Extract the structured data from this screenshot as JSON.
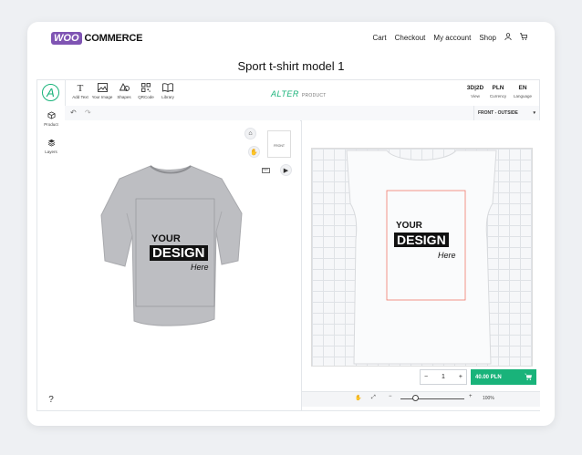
{
  "nav": {
    "logo_woo": "WOO",
    "logo_commerce": "COMMERCE",
    "links": [
      "Cart",
      "Checkout",
      "My account",
      "Shop"
    ]
  },
  "page_title": "Sport t-shirt model 1",
  "brand": {
    "circle_letter": "A",
    "name": "ALTER",
    "suffix": "PRODUCT"
  },
  "sidebar": {
    "items": [
      {
        "label": "Product"
      },
      {
        "label": "Layers"
      }
    ],
    "help": "?"
  },
  "toolbar": {
    "tools": [
      {
        "label": "Add Text"
      },
      {
        "label": "Your Image"
      },
      {
        "label": "Shapes"
      },
      {
        "label": "QRCode"
      },
      {
        "label": "Library"
      }
    ],
    "view": {
      "value": "3D|2D",
      "label": "View"
    },
    "currency": {
      "value": "PLN",
      "label": "Currency"
    },
    "language": {
      "value": "EN",
      "label": "Language"
    }
  },
  "view_select": "FRONT - OUTSIDE",
  "preview": {
    "front_thumb": "FRONT"
  },
  "design": {
    "line1": "YOUR",
    "line2": "DESIGN",
    "line3": "Here"
  },
  "cart": {
    "quantity": "1",
    "price": "40.00 PLN"
  },
  "zoom": {
    "value": "100%"
  },
  "colors": {
    "accent": "#19b37a",
    "woo": "#7f54b3",
    "guide": "#f07a6a"
  }
}
